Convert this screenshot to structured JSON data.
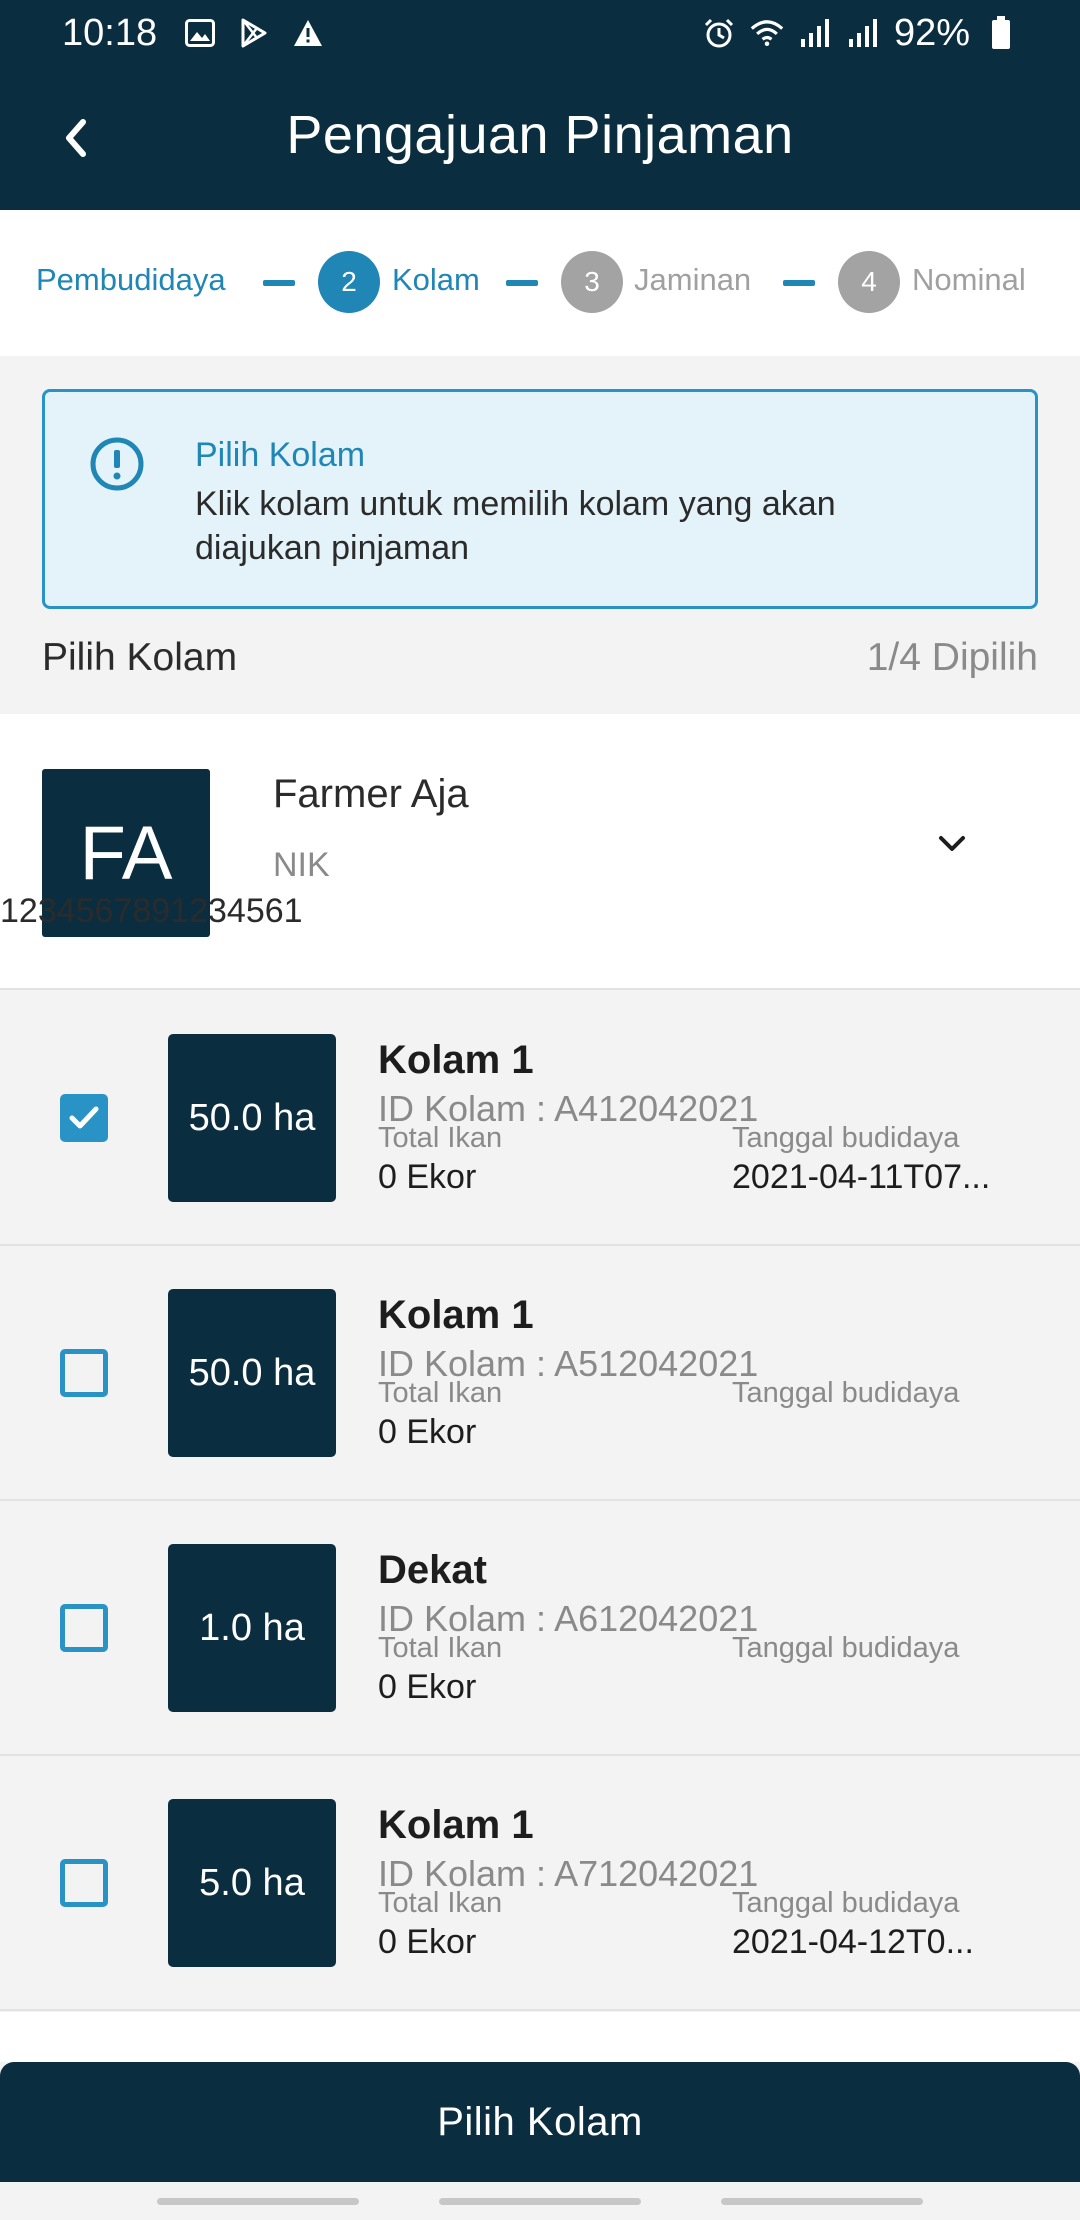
{
  "status_bar": {
    "time": "10:18",
    "battery": "92%",
    "left_icons": [
      "image-icon",
      "play-store-icon",
      "warning-icon"
    ],
    "right_icons": [
      "alarm-icon",
      "wifi-icon",
      "signal-icon",
      "signal-icon",
      "battery-icon"
    ]
  },
  "app_bar": {
    "title": "Pengajuan Pinjaman",
    "back_icon": "chevron-left-icon"
  },
  "stepper": {
    "steps": [
      {
        "number": "",
        "label": "Pembudidaya",
        "state": "done"
      },
      {
        "number": "2",
        "label": "Kolam",
        "state": "active"
      },
      {
        "number": "3",
        "label": "Jaminan",
        "state": "inactive"
      },
      {
        "number": "4",
        "label": "Nominal",
        "state": "inactive"
      }
    ]
  },
  "info": {
    "title": "Pilih Kolam",
    "body": "Klik kolam untuk memilih kolam yang akan diajukan pinjaman",
    "icon": "alert-circle-icon"
  },
  "section": {
    "title": "Pilih Kolam",
    "count": "1/4 Dipilih"
  },
  "farmer": {
    "initials": "FA",
    "name": "Farmer Aja",
    "nik_label": "NIK",
    "nik": "1234567891234561",
    "expand_icon": "chevron-down-icon"
  },
  "ponds": [
    {
      "area": "50.0 ha",
      "name": "Kolam 1",
      "id": "ID Kolam : A412042021",
      "fish_label": "Total Ikan",
      "fish_value": "0 Ekor",
      "date_label": "Tanggal budidaya",
      "date_value": "2021-04-11T07...",
      "checked": true
    },
    {
      "area": "50.0 ha",
      "name": "Kolam 1",
      "id": "ID Kolam : A512042021",
      "fish_label": "Total Ikan",
      "fish_value": "0 Ekor",
      "date_label": "Tanggal budidaya",
      "date_value": "",
      "checked": false
    },
    {
      "area": "1.0 ha",
      "name": "Dekat",
      "id": "ID Kolam : A612042021",
      "fish_label": "Total Ikan",
      "fish_value": "0 Ekor",
      "date_label": "Tanggal budidaya",
      "date_value": "",
      "checked": false
    },
    {
      "area": "5.0 ha",
      "name": "Kolam 1",
      "id": "ID Kolam : A712042021",
      "fish_label": "Total Ikan",
      "fish_value": "0 Ekor",
      "date_label": "Tanggal budidaya",
      "date_value": "2021-04-12T0...",
      "checked": false
    }
  ],
  "cta": {
    "label": "Pilih Kolam"
  },
  "colors": {
    "primary_dark": "#0b2d40",
    "accent": "#1f86b6",
    "info_bg": "#e3f3f9",
    "inactive": "#a3a3a3"
  }
}
